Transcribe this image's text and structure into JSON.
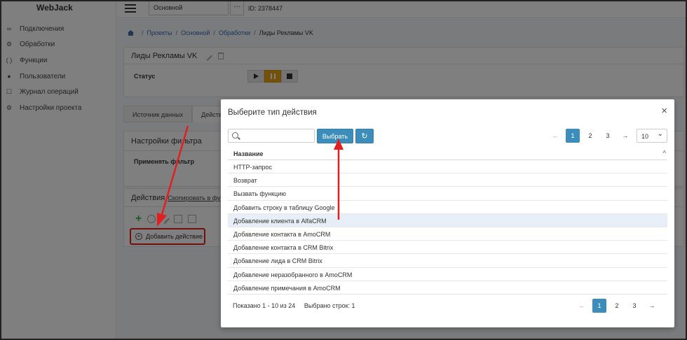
{
  "app": {
    "logo": "WebJack"
  },
  "topbar": {
    "project": "Основной",
    "more": "···",
    "project_id": "ID: 2378447"
  },
  "sidebar": {
    "items": [
      {
        "label": "Подключения",
        "icon": "link-icon",
        "glyph": "∞"
      },
      {
        "label": "Обработки",
        "icon": "gear-icon",
        "glyph": "⚙"
      },
      {
        "label": "Функции",
        "icon": "braces-icon",
        "glyph": "( )"
      },
      {
        "label": "Пользователи",
        "icon": "user-icon",
        "glyph": "●"
      },
      {
        "label": "Журнал операций",
        "icon": "journal-icon",
        "glyph": "☐"
      },
      {
        "label": "Настройки проекта",
        "icon": "settings-icon",
        "glyph": "⚙"
      }
    ]
  },
  "breadcrumb": {
    "b1": "Проекты",
    "b2": "Основной",
    "b3": "Обработки",
    "b4": "Лиды Рекламы VK",
    "sep": "/"
  },
  "process": {
    "title": "Лиды Рекламы VK",
    "status_label": "Статус"
  },
  "tabs": {
    "t1": "Источник данных",
    "t2": "Действ"
  },
  "filter": {
    "title": "Настройки фильтра",
    "apply": "Применять фильтр"
  },
  "actions": {
    "title": "Действия",
    "copy_link": "Скопировать в фу",
    "add_label": "Добавить действие"
  },
  "modal": {
    "title": "Выберите тип действия",
    "close": "×",
    "search_placeholder": "",
    "select_label": "Выбрать",
    "refresh_glyph": "↻",
    "column": "Название",
    "sort_glyph": "^",
    "rows": [
      "HTTP-запрос",
      "Возврат",
      "Вызвать функцию",
      "Добавить строку в таблицу Google",
      "Добавление клиента в AlfaCRM",
      "Добавление контакта в AmoCRM",
      "Добавление контакта в CRM Bitrix",
      "Добавление лида в CRM Bitrix",
      "Добавление неразобранного в AmoCRM",
      "Добавление примечания в AmoCRM"
    ],
    "selected_row": 4,
    "pager": {
      "prev": "←",
      "next": "→",
      "p1": "1",
      "p2": "2",
      "p3": "3",
      "per_page": "10"
    },
    "footer": {
      "shown": "Показано 1 - 10 из 24",
      "selected": "Выбрано строк: 1"
    }
  },
  "colors": {
    "accent": "#3c8dbc",
    "annotation": "#e02020",
    "pause_active": "#e8a317"
  }
}
